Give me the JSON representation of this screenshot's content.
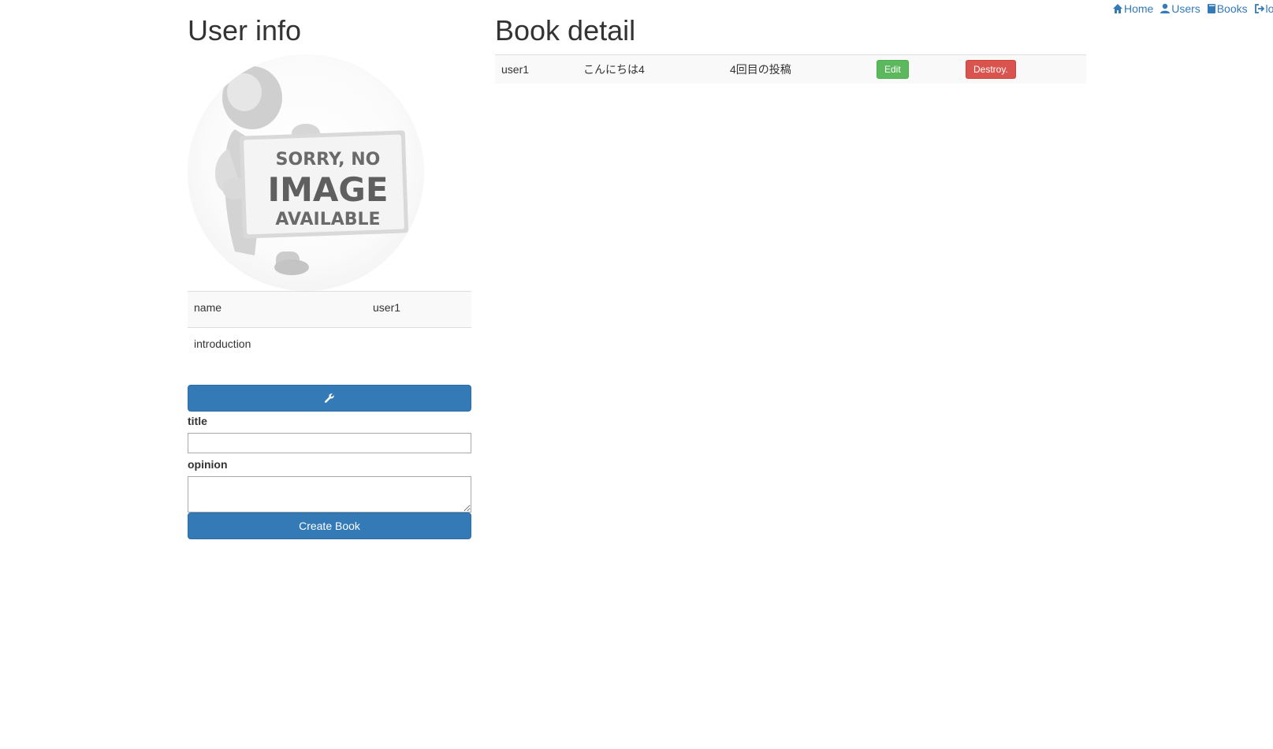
{
  "nav": {
    "items": [
      {
        "label": "Home",
        "icon": "home-icon"
      },
      {
        "label": "Users",
        "icon": "user-icon"
      },
      {
        "label": "Books",
        "icon": "book-icon"
      },
      {
        "label": "logout",
        "icon": "log-out-icon"
      }
    ]
  },
  "user_info": {
    "heading": "User info",
    "avatar_text": {
      "line1": "SORRY, NO",
      "line2": "IMAGE",
      "line3": "AVAILABLE"
    },
    "rows": [
      {
        "key": "name",
        "value": "user1"
      },
      {
        "key": "introduction",
        "value": ""
      }
    ],
    "edit_icon": "wrench-icon"
  },
  "book_form": {
    "title_label": "title",
    "title_value": "",
    "opinion_label": "opinion",
    "opinion_value": "",
    "submit_label": "Create Book"
  },
  "book_detail": {
    "heading": "Book detail",
    "row": {
      "user": "user1",
      "title": "こんにちは4",
      "body": "4回目の投稿",
      "edit_label": "Edit",
      "destroy_label": "Destroy."
    }
  },
  "colors": {
    "primary": "#337ab7",
    "success": "#5cb85c",
    "danger": "#d9534f",
    "text": "#333333"
  }
}
